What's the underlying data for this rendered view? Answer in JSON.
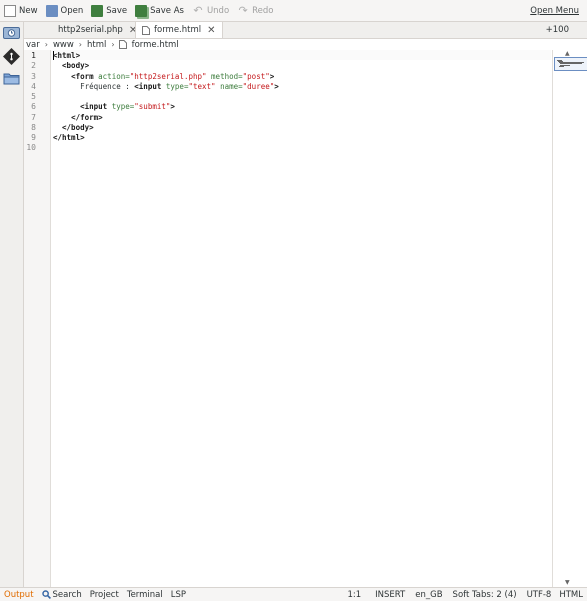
{
  "toolbar": {
    "new_label": "New",
    "open_label": "Open",
    "save_label": "Save",
    "saveas_label": "Save As",
    "undo_label": "Undo",
    "redo_label": "Redo",
    "menu_label": "Open Menu"
  },
  "tabs": [
    {
      "label": "http2serial.php",
      "active": false
    },
    {
      "label": "forme.html",
      "active": true
    }
  ],
  "zoom": "+100",
  "breadcrumb": [
    "var",
    "www",
    "html",
    "forme.html"
  ],
  "editor": {
    "current_line": 1,
    "line_numbers": [
      "1",
      "2",
      "3",
      "4",
      "5",
      "6",
      "7",
      "8",
      "9",
      "10"
    ],
    "lines": [
      {
        "tokens": [
          {
            "t": "tag",
            "v": "<html>"
          }
        ]
      },
      {
        "tokens": [
          {
            "t": "txt",
            "v": "  "
          },
          {
            "t": "tag",
            "v": "<body>"
          }
        ]
      },
      {
        "tokens": [
          {
            "t": "txt",
            "v": "    "
          },
          {
            "t": "tag",
            "v": "<form "
          },
          {
            "t": "attr",
            "v": "action="
          },
          {
            "t": "str",
            "v": "\"http2serial.php\""
          },
          {
            "t": "txt",
            "v": " "
          },
          {
            "t": "attr",
            "v": "method="
          },
          {
            "t": "str",
            "v": "\"post\""
          },
          {
            "t": "tag",
            "v": ">"
          }
        ]
      },
      {
        "tokens": [
          {
            "t": "txt",
            "v": "      Fréquence : "
          },
          {
            "t": "tag",
            "v": "<input "
          },
          {
            "t": "attr",
            "v": "type="
          },
          {
            "t": "str",
            "v": "\"text\""
          },
          {
            "t": "txt",
            "v": " "
          },
          {
            "t": "attr",
            "v": "name="
          },
          {
            "t": "str",
            "v": "\"duree\""
          },
          {
            "t": "tag",
            "v": ">"
          }
        ]
      },
      {
        "tokens": []
      },
      {
        "tokens": [
          {
            "t": "txt",
            "v": "      "
          },
          {
            "t": "tag",
            "v": "<input "
          },
          {
            "t": "attr",
            "v": "type="
          },
          {
            "t": "str",
            "v": "\"submit\""
          },
          {
            "t": "tag",
            "v": ">"
          }
        ]
      },
      {
        "tokens": [
          {
            "t": "txt",
            "v": "    "
          },
          {
            "t": "tag",
            "v": "</form>"
          }
        ]
      },
      {
        "tokens": [
          {
            "t": "txt",
            "v": "  "
          },
          {
            "t": "tag",
            "v": "</body>"
          }
        ]
      },
      {
        "tokens": [
          {
            "t": "tag",
            "v": "</html>"
          }
        ]
      },
      {
        "tokens": []
      }
    ]
  },
  "statusbar": {
    "output": "Output",
    "search": "Search",
    "project": "Project",
    "terminal": "Terminal",
    "lsp": "LSP",
    "position": "1:1",
    "mode": "INSERT",
    "language_dict": "en_GB",
    "indent": "Soft Tabs: 2 (4)",
    "encoding": "UTF-8",
    "filetype": "HTML"
  },
  "icons": {
    "new": "new-document-icon",
    "open": "open-folder-icon",
    "save": "save-icon",
    "saveas": "save-as-icon",
    "undo": "undo-icon",
    "redo": "redo-icon",
    "sidebar_top": "history-icon",
    "sidebar_git": "git-icon",
    "sidebar_files": "file-browser-icon",
    "breadcrumb_file": "file-icon",
    "search": "search-icon"
  },
  "colors": {
    "tag": "#1a1a1a",
    "attribute": "#3c7c3c",
    "string": "#c4191c",
    "output_accent": "#e06c00"
  }
}
